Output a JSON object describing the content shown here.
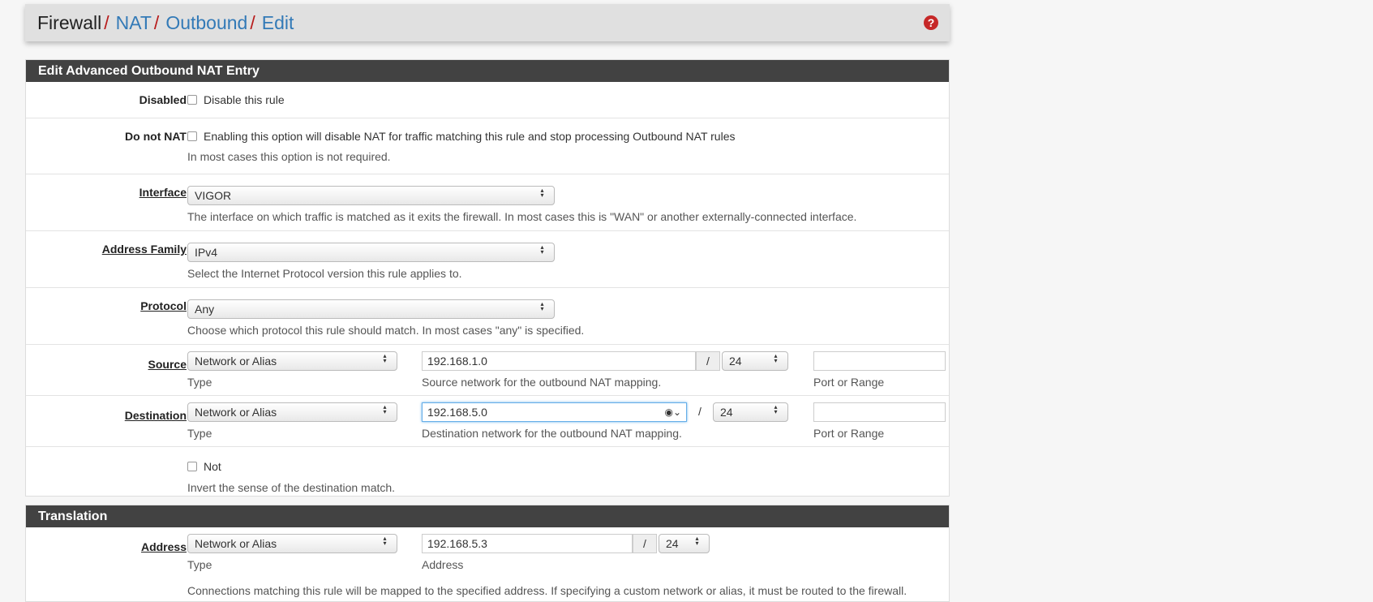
{
  "breadcrumb": {
    "root": "Firewall",
    "items": [
      "NAT",
      "Outbound",
      "Edit"
    ],
    "help_icon": "question-circle-icon"
  },
  "colors": {
    "header_bg": "#424242",
    "link": "#337ab7",
    "separator": "#b71c1c",
    "help": "#c62828"
  },
  "section1": {
    "title": "Edit Advanced Outbound NAT Entry",
    "disabled": {
      "label": "Disabled",
      "checkbox": "Disable this rule",
      "checked": false
    },
    "nonat": {
      "label": "Do not NAT",
      "checkbox": "Enabling this option will disable NAT for traffic matching this rule and stop processing Outbound NAT rules",
      "help": "In most cases this option is not required.",
      "checked": false
    },
    "interface": {
      "label": "Interface",
      "value": "VIGOR",
      "help": "The interface on which traffic is matched as it exits the firewall. In most cases this is \"WAN\" or another externally-connected interface."
    },
    "family": {
      "label": "Address Family",
      "value": "IPv4",
      "help": "Select the Internet Protocol version this rule applies to."
    },
    "protocol": {
      "label": "Protocol",
      "value": "Any",
      "help": "Choose which protocol this rule should match. In most cases \"any\" is specified."
    },
    "source": {
      "label": "Source",
      "type": "Network or Alias",
      "type_help": "Type",
      "address": "192.168.1.0",
      "slash": "/",
      "cidr": "24",
      "address_help": "Source network for the outbound NAT mapping.",
      "port": "",
      "port_help": "Port or Range"
    },
    "destination": {
      "label": "Destination",
      "type": "Network or Alias",
      "type_help": "Type",
      "address": "192.168.5.0",
      "slash": "/",
      "cidr": "24",
      "address_help": "Destination network for the outbound NAT mapping.",
      "port": "",
      "port_help": "Port or Range"
    },
    "not": {
      "checkbox": "Not",
      "help": "Invert the sense of the destination match.",
      "checked": false
    }
  },
  "section2": {
    "title": "Translation",
    "address": {
      "label": "Address",
      "type": "Network or Alias",
      "type_help": "Type",
      "address": "192.168.5.3",
      "slash": "/",
      "cidr": "24",
      "address_help": "Address"
    },
    "help": "Connections matching this rule will be mapped to the specified address. If specifying a custom network or alias, it must be routed to the firewall."
  }
}
